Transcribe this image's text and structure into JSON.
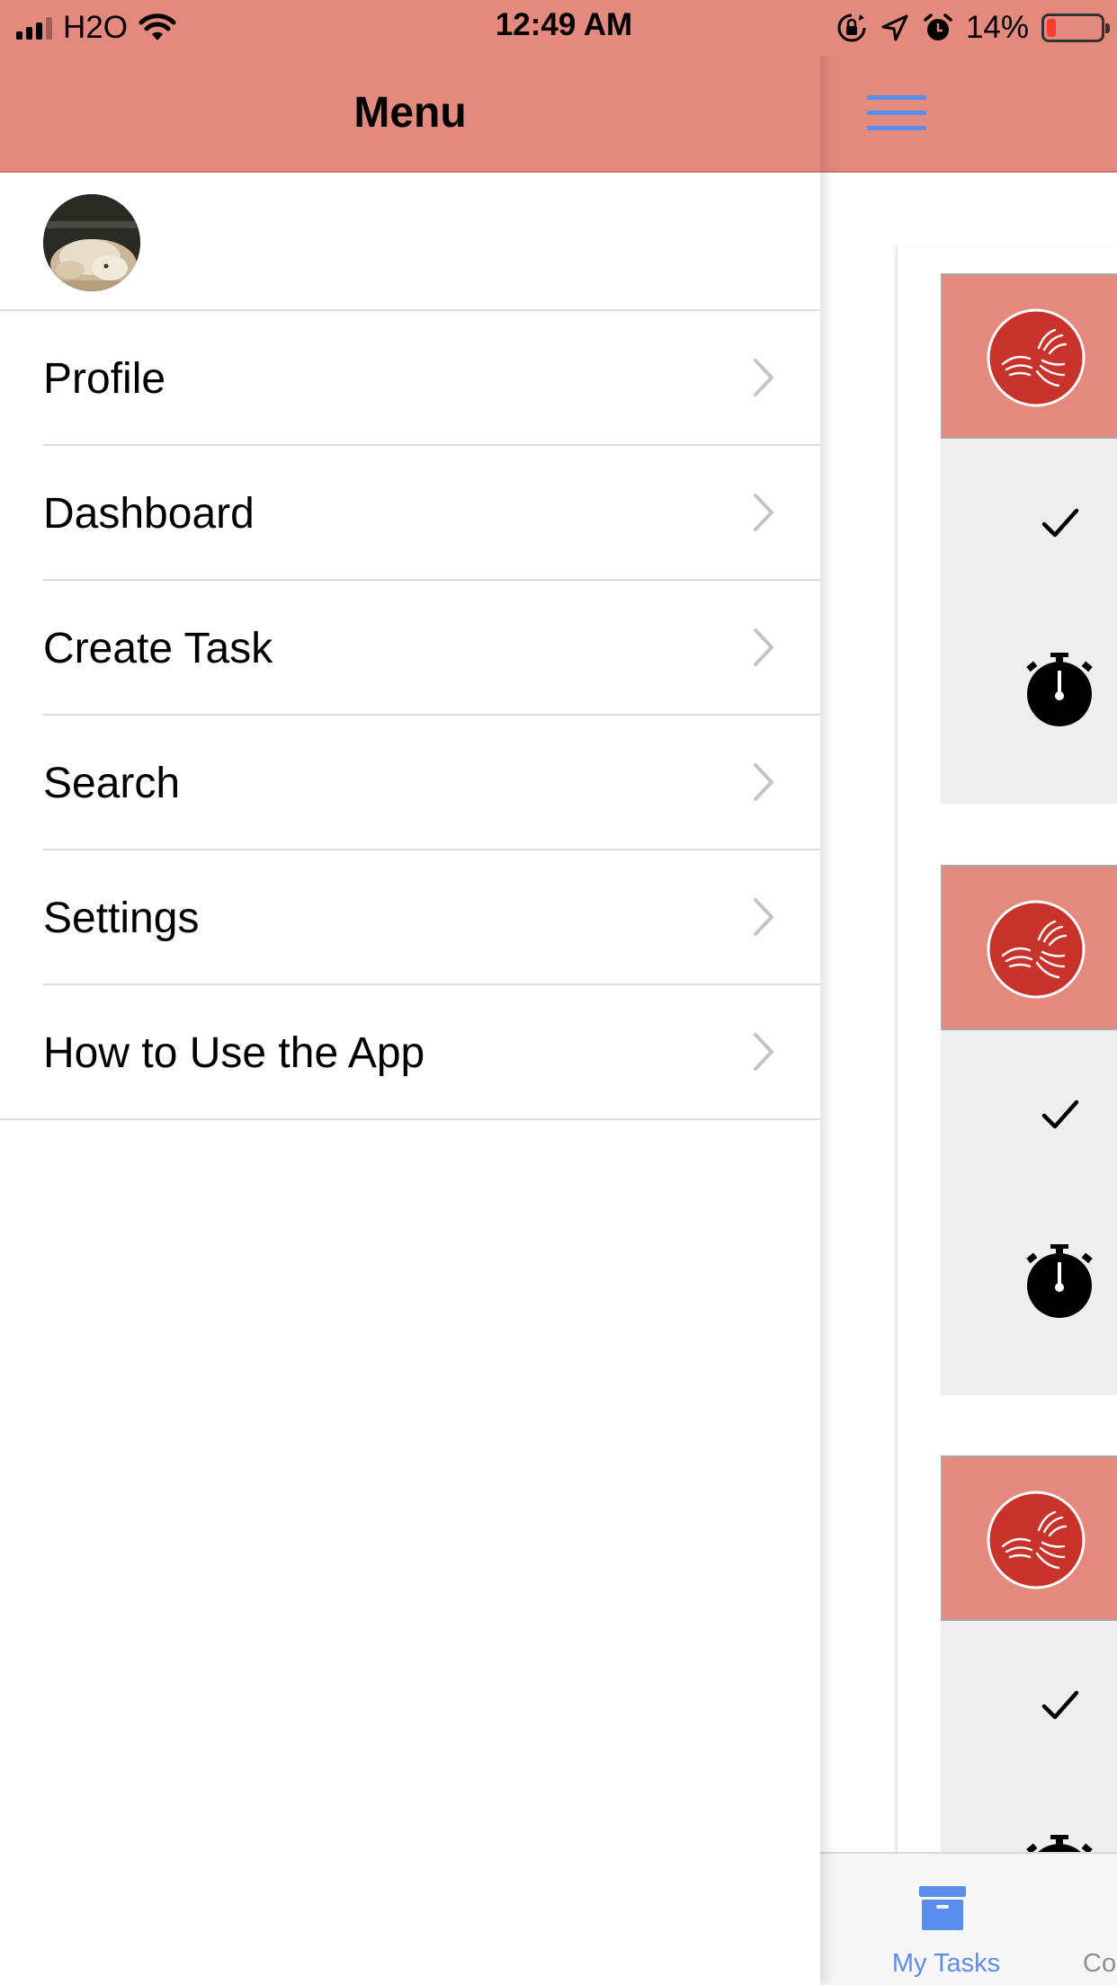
{
  "status_bar": {
    "carrier": "H2O",
    "time": "12:49 AM",
    "battery_percent": "14%",
    "battery_level": 0.14,
    "icons": [
      "signal-icon",
      "wifi-icon",
      "orientation-lock-icon",
      "location-icon",
      "alarm-icon",
      "battery-icon"
    ]
  },
  "menu": {
    "title": "Menu",
    "avatar": "profile-photo-avatar",
    "items": [
      {
        "label": "Profile"
      },
      {
        "label": "Dashboard"
      },
      {
        "label": "Create Task"
      },
      {
        "label": "Search"
      },
      {
        "label": "Settings"
      },
      {
        "label": "How to Use the App"
      }
    ]
  },
  "content": {
    "header_icon": "hamburger-menu-icon",
    "task_cards": [
      {
        "logo": "helping-hands-logo",
        "status_icon": "checkmark-icon",
        "timer_icon": "stopwatch-icon"
      },
      {
        "logo": "helping-hands-logo",
        "status_icon": "checkmark-icon",
        "timer_icon": "stopwatch-icon"
      },
      {
        "logo": "helping-hands-logo",
        "status_icon": "checkmark-icon",
        "timer_icon": "stopwatch-icon"
      }
    ]
  },
  "tab_bar": {
    "tabs": [
      {
        "label": "My Tasks",
        "icon": "archive-box-icon",
        "selected": true
      },
      {
        "label": "Co",
        "selected": false
      }
    ]
  },
  "colors": {
    "header_bg": "#e4897d",
    "accent_blue": "#5b8def",
    "card_bg": "#efefef",
    "logo_red": "#c8332b"
  }
}
